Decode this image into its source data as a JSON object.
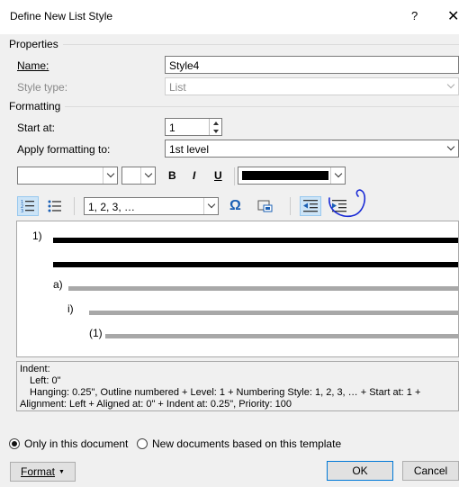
{
  "window": {
    "title": "Define New List Style",
    "help_label": "?",
    "close_label": "✕"
  },
  "properties": {
    "header": "Properties",
    "name_label": "Name:",
    "name_value": "Style4",
    "style_type_label": "Style type:",
    "style_type_value": "List"
  },
  "formatting": {
    "header": "Formatting",
    "start_at_label": "Start at:",
    "start_at_value": "1",
    "apply_label": "Apply formatting to:",
    "apply_value": "1st level",
    "font_name_value": "",
    "font_size_value": "",
    "bold_label": "B",
    "italic_label": "I",
    "underline_label": "U",
    "font_color": "#000000",
    "number_style_value": "1, 2, 3, …",
    "omega_label": "Ω"
  },
  "preview": {
    "level1": "1)",
    "level2": "a)",
    "level3": "i)",
    "level4": "(1)"
  },
  "description": {
    "line1": "Indent:",
    "line2": "Left:  0\"",
    "line3": "Hanging:  0.25\", Outline numbered + Level: 1 + Numbering Style: 1, 2, 3, … + Start at: 1 +",
    "line4": "Alignment: Left + Aligned at:  0\" + Indent at:  0.25\", Priority: 100"
  },
  "options": {
    "only_this_doc": "Only in this document",
    "new_docs": "New documents based on this template",
    "selected": "only_this_doc"
  },
  "footer": {
    "format_label": "Format",
    "ok_label": "OK",
    "cancel_label": "Cancel"
  },
  "colors": {
    "accent": "#0078d7",
    "annotation_circle": "#1a2bd6"
  }
}
